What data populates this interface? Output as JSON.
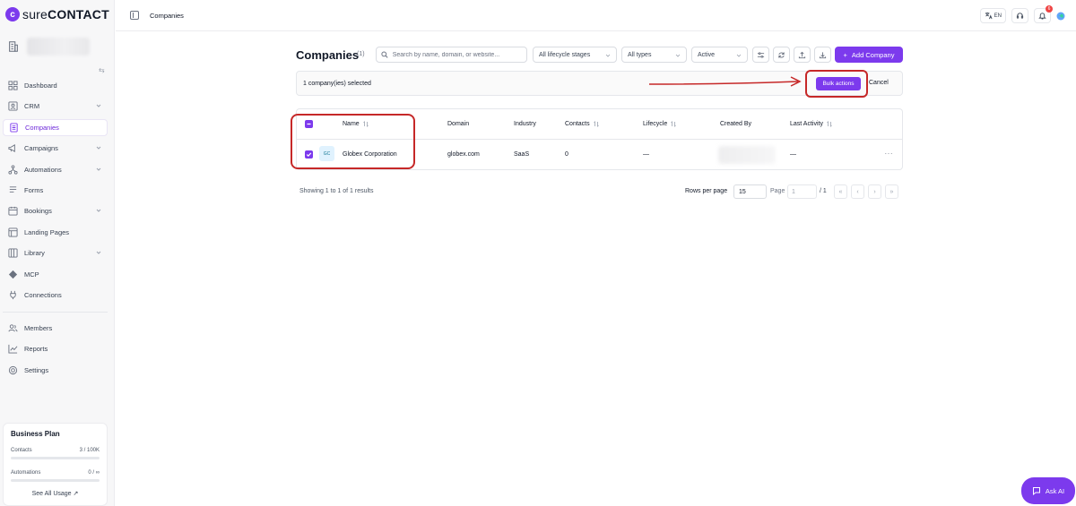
{
  "brand": {
    "prefix": "sure",
    "suffix": "CONTACT"
  },
  "sidebar": {
    "items": [
      {
        "label": "Dashboard",
        "icon": "dashboard-icon"
      },
      {
        "label": "CRM",
        "icon": "crm-icon",
        "expandable": true
      },
      {
        "label": "Companies",
        "icon": "companies-icon",
        "active": true
      },
      {
        "label": "Campaigns",
        "icon": "megaphone-icon",
        "expandable": true
      },
      {
        "label": "Automations",
        "icon": "automation-icon",
        "expandable": true
      },
      {
        "label": "Forms",
        "icon": "forms-icon"
      },
      {
        "label": "Bookings",
        "icon": "calendar-icon",
        "expandable": true
      },
      {
        "label": "Landing Pages",
        "icon": "landing-page-icon"
      },
      {
        "label": "Library",
        "icon": "library-icon",
        "expandable": true
      },
      {
        "label": "MCP",
        "icon": "mcp-icon"
      },
      {
        "label": "Connections",
        "icon": "plug-icon"
      }
    ],
    "bottom_items": [
      {
        "label": "Members",
        "icon": "members-icon"
      },
      {
        "label": "Reports",
        "icon": "reports-icon"
      },
      {
        "label": "Settings",
        "icon": "settings-icon"
      }
    ],
    "plan": {
      "title": "Business Plan",
      "contacts_label": "Contacts",
      "contacts_value": "3 / 100K",
      "automations_label": "Automations",
      "automations_value": "0 / ∞",
      "link": "See All Usage ↗"
    }
  },
  "topbar": {
    "title": "Companies",
    "language": "EN",
    "notification_count": "6"
  },
  "main": {
    "title": "Companies",
    "count": "(1)",
    "search_placeholder": "Search by name, domain, or website...",
    "filters": [
      "All lifecycle stages",
      "All types",
      "Active"
    ],
    "add_button": "Add Company",
    "selection": {
      "text": "1 company(ies) selected",
      "bulk_actions": "Bulk actions",
      "cancel": "Cancel"
    },
    "table": {
      "headers": [
        "Name",
        "Domain",
        "Industry",
        "Contacts",
        "Lifecycle",
        "Created By",
        "Last Activity"
      ],
      "rows": [
        {
          "initials": "GC",
          "name": "Globex Corporation",
          "domain": "globex.com",
          "industry": "SaaS",
          "contacts": "0",
          "lifecycle": "—",
          "last_activity": "—"
        }
      ]
    },
    "pagination": {
      "showing": "Showing 1 to 1 of 1 results",
      "rows_per_page_label": "Rows per page",
      "rows_per_page": "15",
      "page_label": "Page",
      "page_value": "1",
      "page_total": "/ 1"
    }
  },
  "ask_ai": "Ask AI",
  "colors": {
    "accent": "#7c3aed",
    "annotation": "#c62828"
  }
}
